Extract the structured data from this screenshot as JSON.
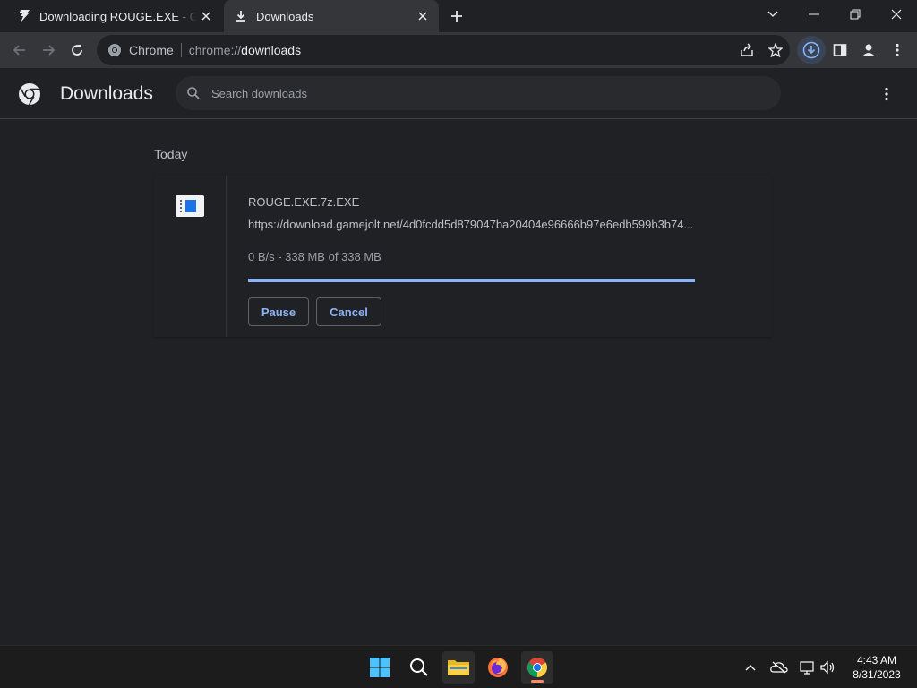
{
  "tabs": [
    {
      "title": "Downloading ROUGE.EXE - Game Jolt",
      "active": false
    },
    {
      "title": "Downloads",
      "active": true
    }
  ],
  "omnibox": {
    "site_label": "Chrome",
    "url_scheme": "chrome://",
    "url_host": "downloads"
  },
  "downloads_page": {
    "title": "Downloads",
    "search_placeholder": "Search downloads",
    "section_label": "Today",
    "item": {
      "file_name": "ROUGE.EXE.7z.EXE",
      "url": "https://download.gamejolt.net/4d0fcdd5d879047ba20404e96666b97e6edb599b3b74...",
      "progress_text": "0 B/s - 338 MB of 338 MB",
      "progress_fraction": 1.0,
      "pause_label": "Pause",
      "cancel_label": "Cancel"
    }
  },
  "taskbar": {
    "time": "4:43 AM",
    "date": "8/31/2023"
  },
  "colors": {
    "accent": "#8ab4f8",
    "background": "#202124",
    "toolbar": "#35363a"
  }
}
